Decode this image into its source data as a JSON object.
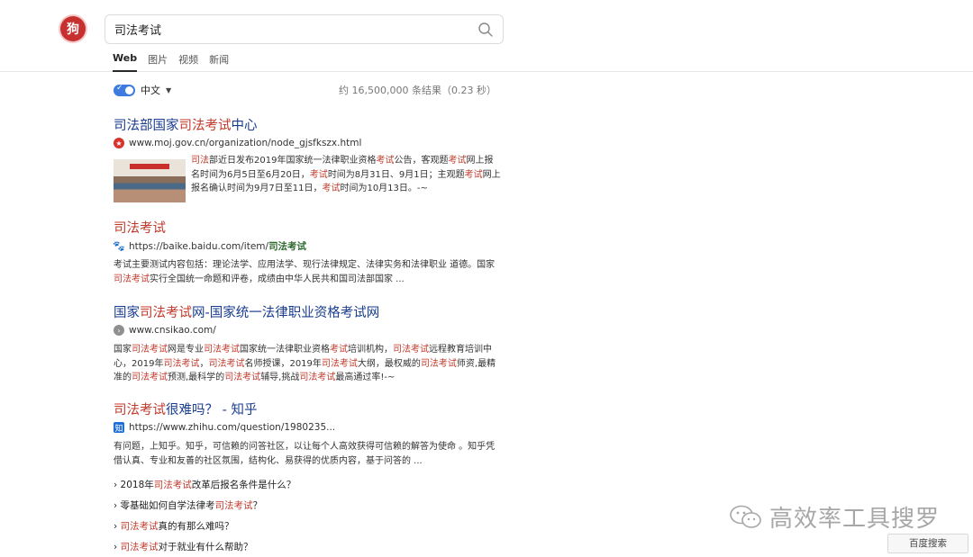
{
  "header": {
    "logo_text": "狗",
    "search_value": "司法考试",
    "tabs": [
      {
        "label": "Web"
      },
      {
        "label": "图片"
      },
      {
        "label": "视频"
      },
      {
        "label": "新闻"
      }
    ]
  },
  "toolbar": {
    "language": "中文",
    "result_count": "约 16,500,000 条结果（0.23 秒）"
  },
  "results": [
    {
      "title_parts": [
        "司法部国家",
        "司法考试",
        "中心"
      ],
      "url": "www.moj.gov.cn/organization/node_gjsfkszx.html",
      "snippet_parts": [
        "",
        "司法",
        "部近日发布2019年国家统一法律职业资格",
        "考试",
        "公告，客观题",
        "考试",
        "网上报名时间为6月5日至6月20日，",
        "考试",
        "时间为8月31日、9月1日；主观题",
        "考试",
        "网上报名确认时间为9月7日至11日，",
        "考试",
        "时间为10月13日。-~"
      ]
    },
    {
      "title": "司法考试",
      "url_prefix": "https://baike.baidu.com/item/",
      "url_highlight": "司法考试",
      "snippet_parts": [
        "考试主要测试内容包括：理论法学、应用法学、现行法律规定、法律实务和法律职业 道德。国家",
        "司法考试",
        "实行全国统一命题和评卷，成绩由中华人民共和国司法部国家 ..."
      ]
    },
    {
      "title_parts": [
        "国家",
        "司法考试",
        "网-国家统一法律职业资格考试网"
      ],
      "url": "www.cnsikao.com/",
      "snippet_parts": [
        "国家",
        "司法考试",
        "网是专业",
        "司法考试",
        "国家统一法律职业资格",
        "考试",
        "培训机构，",
        "司法考试",
        "远程教育培训中心，2019年",
        "司法考试",
        "，",
        "司法考试",
        "名师授课，2019年",
        "司法考试",
        "大纲，最权威的",
        "司法考试",
        "师资,最精准的",
        "司法考试",
        "预测,最科学的",
        "司法考试",
        "辅导,挑战",
        "司法考试",
        "最高通过率!-~"
      ]
    },
    {
      "title_parts": [
        "",
        "司法考试",
        "很难吗？ - 知乎"
      ],
      "url": "https://www.zhihu.com/question/1980235...",
      "favicon": "知",
      "snippet": "有问题，上知乎。知乎，可信赖的问答社区，以让每个人高效获得可信赖的解答为使命 。知乎凭借认真、专业和友善的社区氛围，结构化、易获得的优质内容，基于问答的 ...",
      "sub_links": [
        {
          "before": "› 2018年",
          "hl": "司法考试",
          "after": "改革后报名条件是什么？"
        },
        {
          "before": "› 零基础如何自学法律考",
          "hl": "司法考试",
          "after": "？"
        },
        {
          "before": "› ",
          "hl": "司法考试",
          "after": "真的有那么难吗？"
        },
        {
          "before": "› ",
          "hl": "司法考试",
          "after": "对于就业有什么帮助？"
        }
      ]
    }
  ],
  "watermark": "高效率工具搜罗",
  "baidu_button": "百度搜索"
}
